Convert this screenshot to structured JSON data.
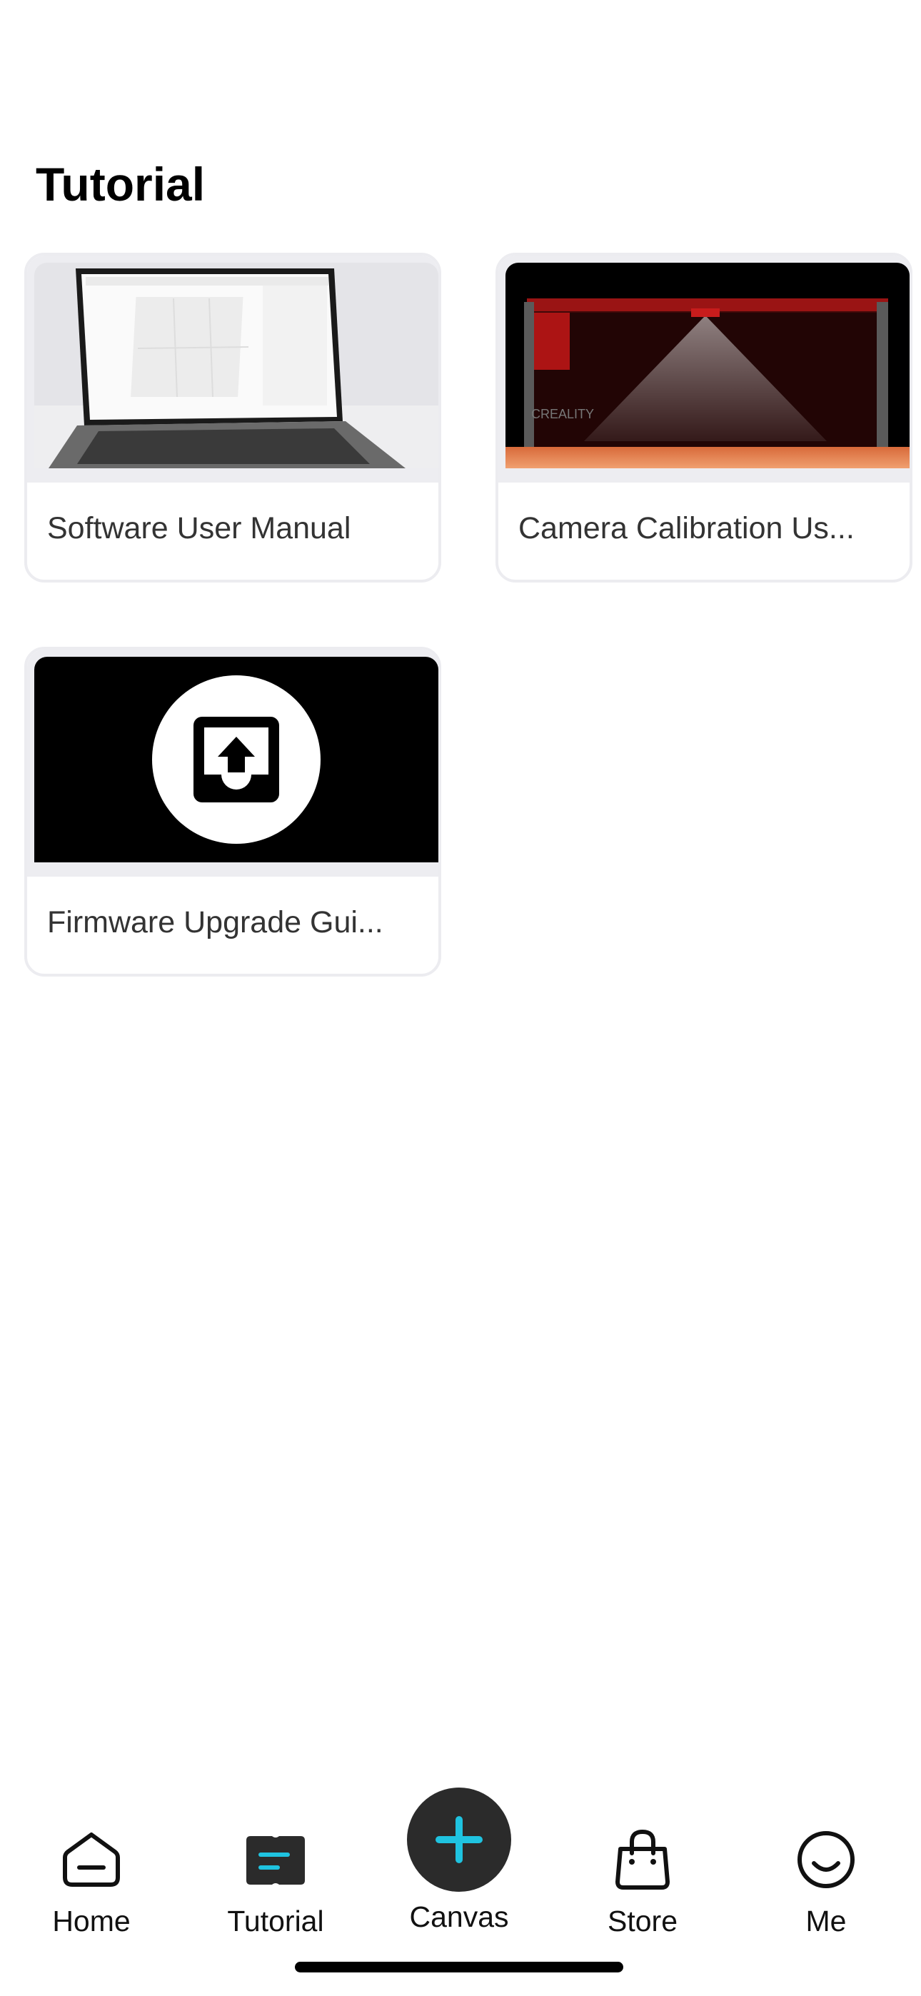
{
  "page": {
    "title": "Tutorial"
  },
  "tutorials": [
    {
      "label": "Software User Manual",
      "thumbnail": "laptop-software-screenshot"
    },
    {
      "label": "Camera Calibration Us...",
      "thumbnail": "laser-engraver-camera-view"
    },
    {
      "label": "Firmware Upgrade Gui...",
      "thumbnail": "upload-icon-on-black"
    }
  ],
  "tabbar": {
    "home": {
      "label": "Home",
      "icon": "home-icon"
    },
    "tutorial": {
      "label": "Tutorial",
      "icon": "book-icon"
    },
    "canvas": {
      "label": "Canvas",
      "icon": "plus-icon"
    },
    "store": {
      "label": "Store",
      "icon": "shopping-bag-icon"
    },
    "me": {
      "label": "Me",
      "icon": "smile-icon"
    }
  },
  "colors": {
    "accent": "#1fc3e0",
    "active_tab_icon": "#2b2b2b",
    "card_border": "#ececf0"
  }
}
